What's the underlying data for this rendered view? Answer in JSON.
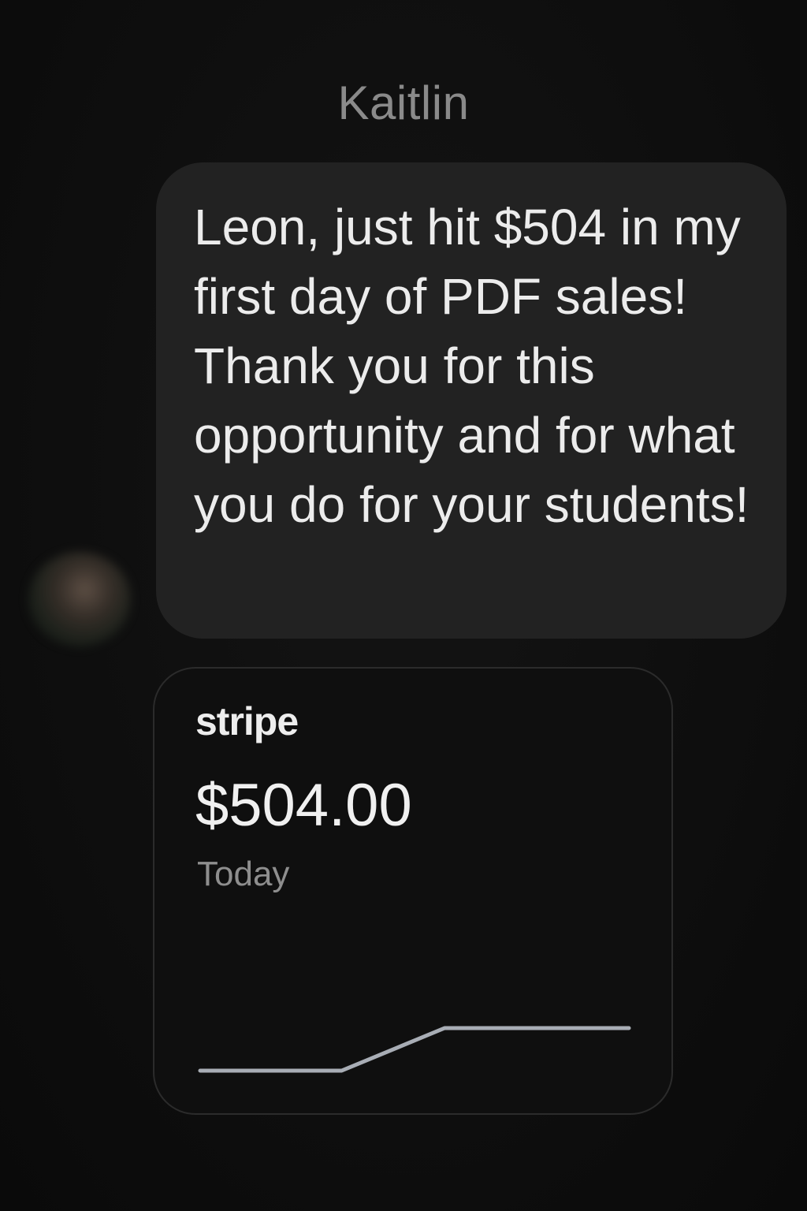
{
  "conversation": {
    "contact_name": "Kaitlin"
  },
  "message": {
    "text": "Leon, just hit $504 in my first day of PDF sales! Thank you for this opportunity and for what you do for your students!"
  },
  "stripe_card": {
    "brand": "stripe",
    "amount": "$504.00",
    "period": "Today",
    "line_color": "#a8adb5"
  },
  "chart_data": {
    "type": "line",
    "title": "",
    "xlabel": "",
    "ylabel": "",
    "grid": false,
    "x": [
      0,
      0.33,
      0.57,
      1.0
    ],
    "series": [
      {
        "values": [
          0,
          0,
          504,
          504
        ]
      }
    ],
    "ylim": [
      0,
      504
    ]
  }
}
